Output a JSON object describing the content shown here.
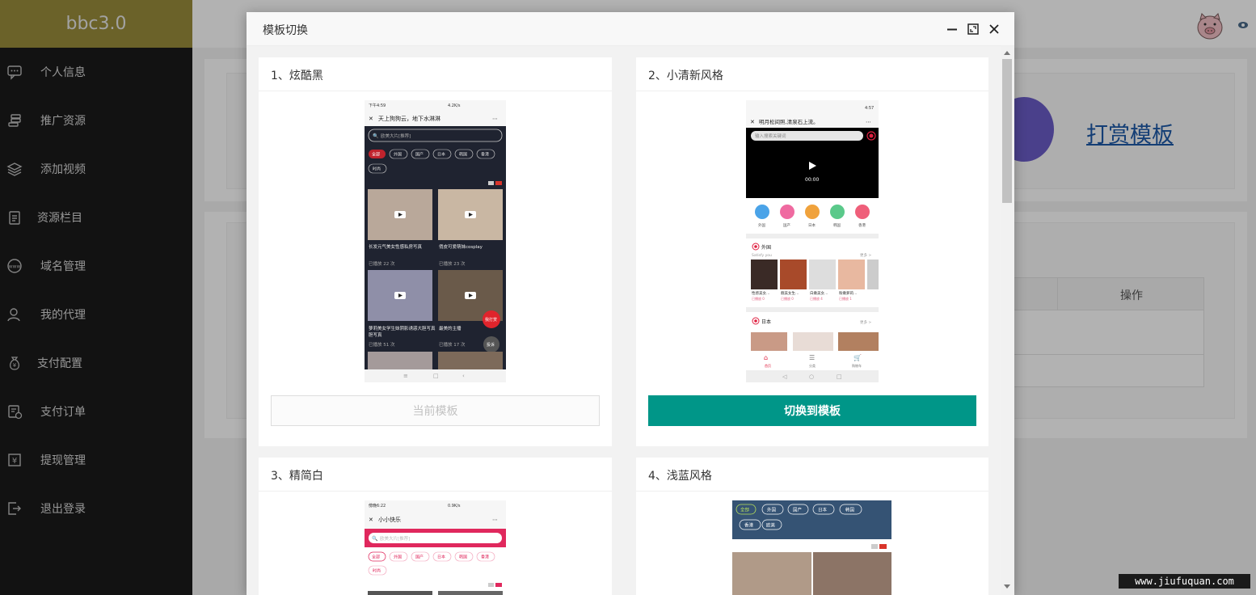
{
  "brand": "bbc3.0",
  "sidebar": {
    "items": [
      {
        "label": "个人信息",
        "icon": "chat-icon"
      },
      {
        "label": "推广资源",
        "icon": "coins-icon"
      },
      {
        "label": "添加视频",
        "icon": "layers-icon"
      },
      {
        "label": "资源栏目",
        "icon": "clipboard-icon"
      },
      {
        "label": "域名管理",
        "icon": "www-icon"
      },
      {
        "label": "我的代理",
        "icon": "user-icon"
      },
      {
        "label": "支付配置",
        "icon": "money-bag-icon"
      },
      {
        "label": "支付订单",
        "icon": "invoice-icon"
      },
      {
        "label": "提现管理",
        "icon": "withdraw-icon"
      },
      {
        "label": "退出登录",
        "icon": "logout-icon"
      }
    ]
  },
  "background": {
    "reward_link": "打赏模板",
    "table_header_op": "操作"
  },
  "modal": {
    "title": "模板切换",
    "templates": [
      {
        "name": "1、炫酷黑",
        "button": "当前模板",
        "current": true
      },
      {
        "name": "2、小清新风格",
        "button": "切换到模板",
        "current": false
      },
      {
        "name": "3、精简白",
        "button": "",
        "current": false
      },
      {
        "name": "4、浅蓝风格",
        "button": "",
        "current": false
      }
    ]
  },
  "previews": {
    "t1": {
      "status_time": "下午4:59",
      "status_net": "4.2K/s",
      "title": "天上狗狗云，地下水淋淋",
      "search": "欧美大片[推荐]",
      "tags": [
        "全部",
        "外国",
        "国产",
        "日本",
        "韩国",
        "香港",
        "时尚"
      ],
      "videos": [
        {
          "title": "长发元气美女性感私房写真",
          "plays": "已播放 22 次"
        },
        {
          "title": "俏皮可爱萌妹cosplay",
          "plays": "已播放 23 次"
        },
        {
          "title": "萝莉美女学生妹阴影诱惑大胆写真",
          "plays": "已播放 51 次"
        },
        {
          "title": "最美的主播",
          "plays": "已播放 17 次"
        }
      ],
      "float_red": "我打赏",
      "float_gray": "投诉"
    },
    "t2": {
      "status_time": "4:57",
      "title": "明月松间照,清泉石上流。",
      "search": "输入搜索关键词",
      "player_time": "00:00",
      "cats": [
        "外国",
        "国产",
        "日本",
        "韩国",
        "香港"
      ],
      "section1": "外国",
      "section1_sub": "Satisfy you",
      "section1_more": "更多 >",
      "thumbs1": [
        {
          "title": "性感美女…",
          "plays": "已播放 0"
        },
        {
          "title": "靓美女生…",
          "plays": "已播放 0"
        },
        {
          "title": "白嫩美女…",
          "plays": "已播放 4"
        },
        {
          "title": "粉嫩萝莉…",
          "plays": "已播放 1"
        }
      ],
      "section2": "日本",
      "section2_more": "更多 >",
      "tabs": [
        "首页",
        "分类",
        "购物车"
      ]
    },
    "t3": {
      "status_time": "傍晚6:22",
      "status_net": "0.9K/s",
      "title": "小小快乐",
      "search": "欧美大片[推荐]",
      "tags": [
        "全部",
        "外国",
        "国产",
        "日本",
        "韩国",
        "香港",
        "时尚"
      ]
    },
    "t4": {
      "tags": [
        "全部",
        "外国",
        "国产",
        "日本",
        "韩国",
        "香港",
        "欧美"
      ]
    }
  },
  "watermark": "www.jiufuquan.com",
  "colors": {
    "sidebar_bg": "#1b1b1b",
    "brand_bg": "#9a8d3c",
    "primary": "#009688",
    "dark_preview": "#1f2330",
    "pink": "#e0285d",
    "blue_preview": "#355374"
  }
}
